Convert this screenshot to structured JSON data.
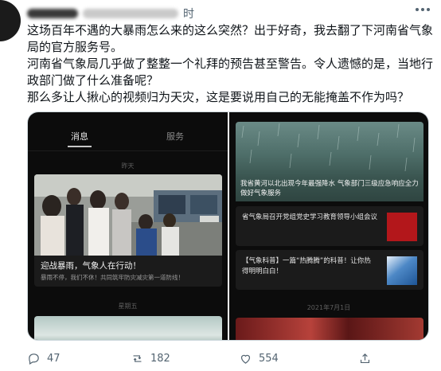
{
  "header": {
    "time": "时"
  },
  "tweet": {
    "lines": [
      "这场百年不遇的大暴雨怎么来的这么突然？出于好奇，我去翻了下河南省气象局的官方服务号。",
      "河南省气象局几乎做了整整一个礼拜的预告甚至警告。令人遗憾的是，当地行政部门做了什么准备呢？",
      "那么多让人揪心的视频归为天灾，这是要说用自己的无能掩盖不作为吗？"
    ]
  },
  "left_panel": {
    "tab_active": "消息",
    "tab_service": "服务",
    "date1": "昨天",
    "card_title": "迎战暴雨，气象人在行动！",
    "card_sub": "暴雨不停，我们不休！共同筑牢防灾减灾第一道防线！",
    "date2": "星期五"
  },
  "right_panel": {
    "hero_text": "我省黄河以北出现今年最强降水 气象部门三级应急响应全力做好气象服务",
    "item1": "省气象局召开党组党史学习教育领导小组会议",
    "item2": "【气象科普】一篇“热腾腾”的科普！让你热得明明白白！",
    "date": "2021年7月1日"
  },
  "actions": {
    "replies": "47",
    "retweets": "182",
    "likes": "554"
  },
  "icons": [
    "reply-icon",
    "retweet-icon",
    "like-icon",
    "share-icon",
    "more-icon"
  ]
}
